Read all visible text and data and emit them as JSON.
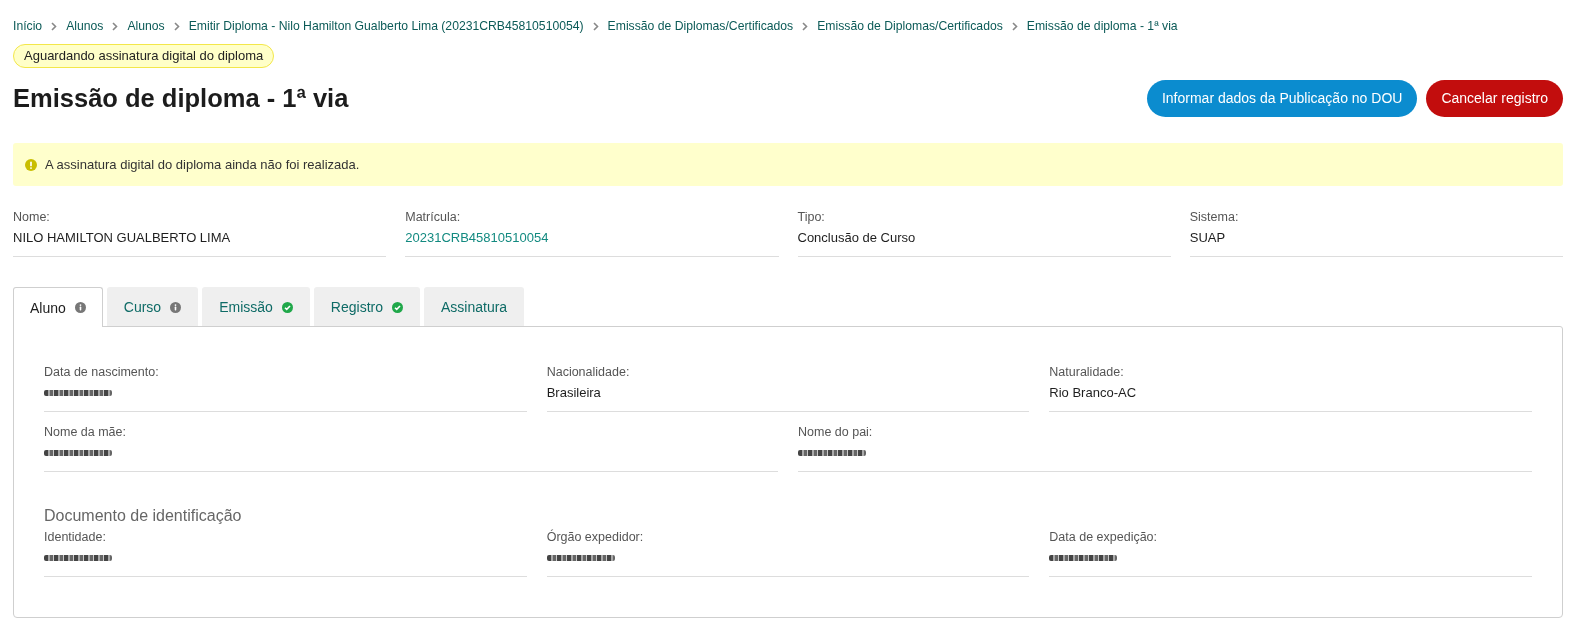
{
  "breadcrumb": [
    "Início",
    "Alunos",
    "Alunos",
    "Emitir Diploma - Nilo Hamilton Gualberto Lima (20231CRB45810510054)",
    "Emissão de Diplomas/Certificados",
    "Emissão de Diplomas/Certificados",
    "Emissão de diploma - 1ª via"
  ],
  "status_badge": "Aguardando assinatura digital do diploma",
  "title": "Emissão de diploma - 1ª via",
  "actions": [
    {
      "label": "Informar dados da Publicação no DOU",
      "kind": "primary"
    },
    {
      "label": "Cancelar registro",
      "kind": "danger"
    }
  ],
  "alert": {
    "kind": "warning",
    "text": "A assinatura digital do diploma ainda não foi realizada."
  },
  "summary": [
    {
      "label": "Nome:",
      "value": "NILO HAMILTON GUALBERTO LIMA",
      "link": false
    },
    {
      "label": "Matrícula:",
      "value": "20231CRB45810510054",
      "link": true
    },
    {
      "label": "Tipo:",
      "value": "Conclusão de Curso",
      "link": false
    },
    {
      "label": "Sistema:",
      "value": "SUAP",
      "link": false
    }
  ],
  "tabs": [
    {
      "label": "Aluno",
      "kind": "info",
      "selected": true
    },
    {
      "label": "Curso",
      "kind": "info",
      "selected": false
    },
    {
      "label": "Emissão",
      "kind": "complete",
      "selected": false
    },
    {
      "label": "Registro",
      "kind": "complete",
      "selected": false
    },
    {
      "label": "Assinatura",
      "kind": "plain",
      "selected": false
    }
  ],
  "panel": {
    "sections": [
      {
        "rows": [
          {
            "fields": [
              {
                "label": "Data de nascimento:",
                "redacted": true
              },
              {
                "label": "Nacionalidade:",
                "value": "Brasileira",
                "redacted": false
              },
              {
                "label": "Naturalidade:",
                "value": "Rio Branco-AC",
                "redacted": false
              }
            ]
          },
          {
            "fields": [
              {
                "label": "Nome da mãe:",
                "redacted": true
              },
              {
                "label": "Nome do pai:",
                "redacted": true
              }
            ]
          }
        ]
      },
      {
        "title": "Documento de identificação",
        "rows": [
          {
            "fields": [
              {
                "label": "Identidade:",
                "redacted": true
              },
              {
                "label": "Órgão expedidor:",
                "redacted": true
              },
              {
                "label": "Data de expedição:",
                "redacted": true
              }
            ]
          }
        ]
      }
    ]
  }
}
